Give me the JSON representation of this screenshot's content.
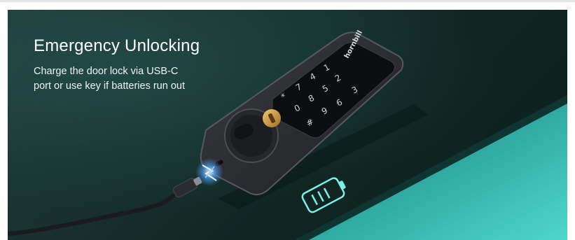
{
  "banner": {
    "title": "Emergency Unlocking",
    "description_line1": "Charge the door lock via USB-C",
    "description_line2": "port or use key if batteries run out",
    "brand": "hornbill",
    "keypad": [
      "1",
      "2",
      "3",
      "4",
      "5",
      "6",
      "7",
      "8",
      "9",
      "*",
      "0",
      "#"
    ]
  },
  "colors": {
    "background": "#17302d",
    "table_teal": "#3fc6be",
    "battery_icon": "#79f0ea",
    "lock_body": "#2b2d30",
    "key_cylinder": "#c99a4b",
    "spark": "#6fb9ff"
  },
  "icons": [
    "battery-icon",
    "lightning-spark-icon",
    "usb-c-connector-icon"
  ]
}
